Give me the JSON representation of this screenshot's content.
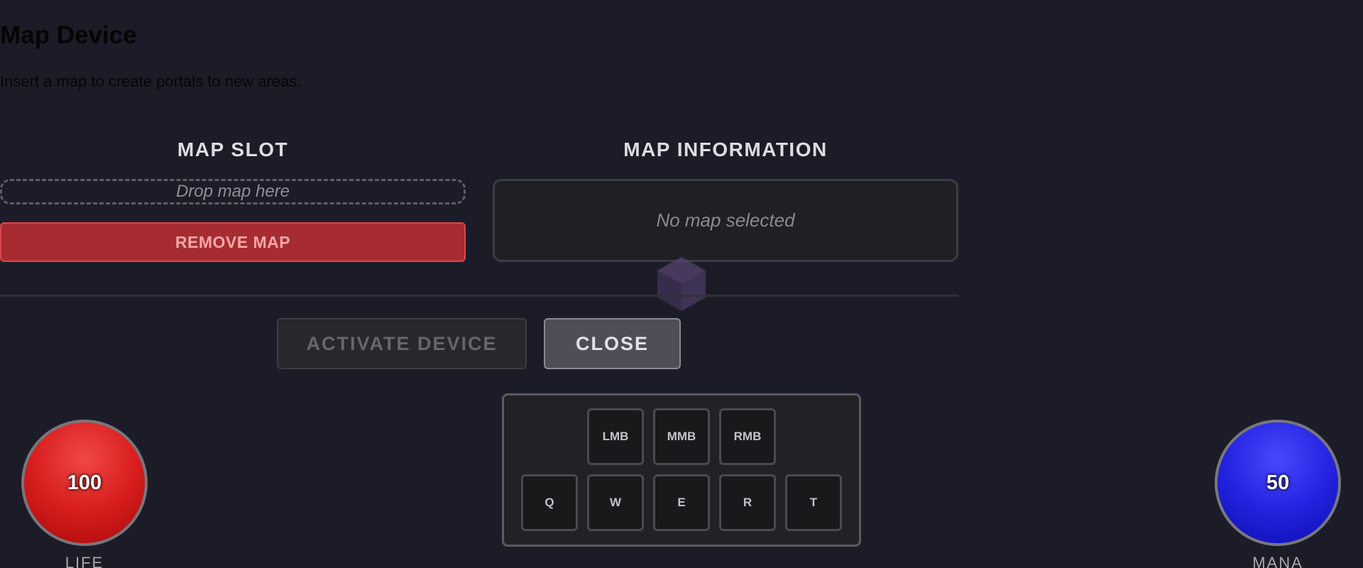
{
  "page": {
    "title": "Map Device",
    "description": "Insert a map to create portals to new areas."
  },
  "map_slot": {
    "heading": "MAP SLOT",
    "drop_placeholder": "Drop map here",
    "remove_label": "REMOVE MAP"
  },
  "map_info": {
    "heading": "MAP INFORMATION",
    "empty_text": "No map selected"
  },
  "actions": {
    "activate_label": "ACTIVATE DEVICE",
    "close_label": "CLOSE"
  },
  "hotbar": {
    "mouse_keys": [
      "LMB",
      "MMB",
      "RMB"
    ],
    "skill_keys": [
      "Q",
      "W",
      "E",
      "R",
      "T"
    ]
  },
  "life": {
    "value": "100",
    "label": "LIFE",
    "color": "#d81e1e"
  },
  "mana": {
    "value": "50",
    "label": "MANA",
    "color": "#2424e0"
  },
  "colors": {
    "background": "#1c1c28",
    "remove_button": "#a62c32",
    "close_button": "#4e4e58",
    "device_crystal": "#4a3a63"
  },
  "icons": {
    "device": "purple-cube-icon"
  }
}
